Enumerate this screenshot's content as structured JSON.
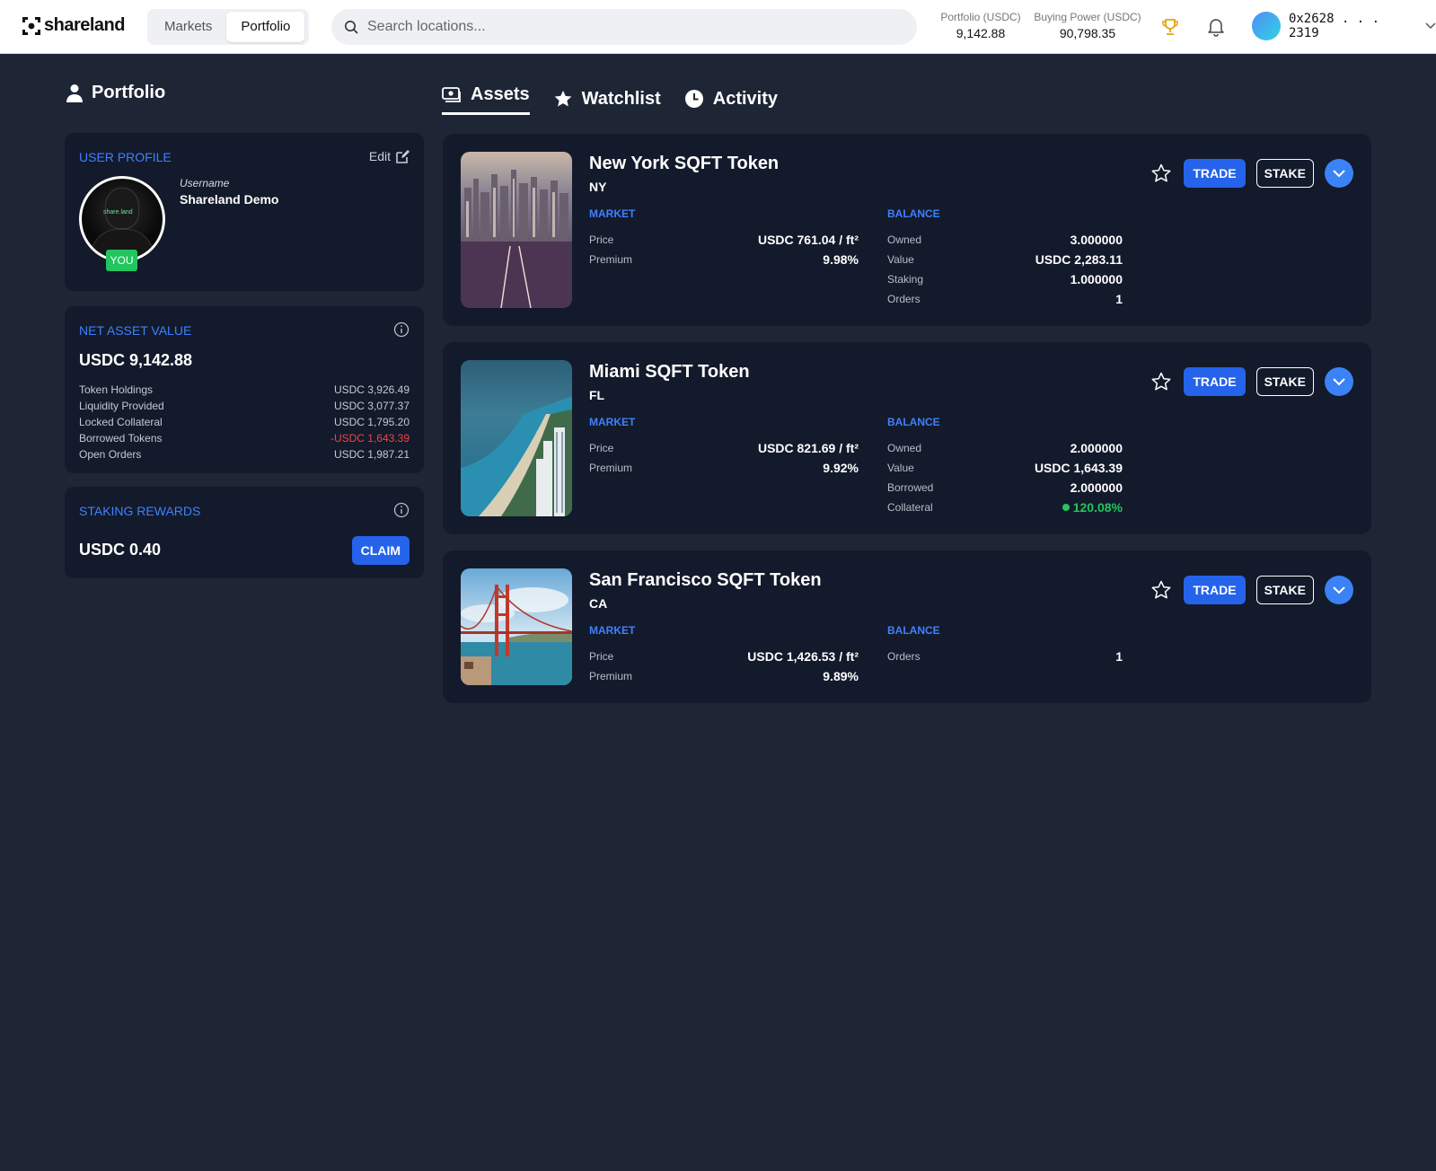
{
  "header": {
    "logo_text": "shareland",
    "nav_tabs": [
      {
        "label": "Markets"
      },
      {
        "label": "Portfolio"
      }
    ],
    "search_placeholder": "Search locations...",
    "portfolio_label": "Portfolio (USDC)",
    "portfolio_value": "9,142.88",
    "buying_power_label": "Buying Power (USDC)",
    "buying_power_value": "90,798.35",
    "wallet_address": "0x2628 . . . 2319",
    "accent_color": "#2563eb"
  },
  "sidebar": {
    "title": "Portfolio",
    "profile": {
      "section_title": "USER PROFILE",
      "edit_label": "Edit",
      "username_label": "Username",
      "username": "Shareland Demo",
      "you_badge": "YOU",
      "avatar_logo_text": "share.land"
    },
    "net_asset": {
      "section_title": "NET ASSET VALUE",
      "total": "USDC 9,142.88",
      "rows": [
        {
          "label": "Token Holdings",
          "value": "USDC 3,926.49"
        },
        {
          "label": "Liquidity Provided",
          "value": "USDC 3,077.37"
        },
        {
          "label": "Locked Collateral",
          "value": "USDC 1,795.20"
        },
        {
          "label": "Borrowed Tokens",
          "value": "-USDC 1,643.39"
        },
        {
          "label": "Open Orders",
          "value": "USDC 1,987.21"
        }
      ]
    },
    "staking": {
      "section_title": "STAKING REWARDS",
      "total": "USDC 0.40",
      "claim_label": "CLAIM"
    }
  },
  "tabs": [
    {
      "label": "Assets",
      "icon": "money-icon"
    },
    {
      "label": "Watchlist",
      "icon": "star-icon"
    },
    {
      "label": "Activity",
      "icon": "clock-icon"
    }
  ],
  "assets": [
    {
      "name": "New York SQFT Token",
      "state": "NY",
      "market_title": "MARKET",
      "balance_title": "BALANCE",
      "price_label": "Price",
      "price": "USDC 761.04 / ft²",
      "premium_label": "Premium",
      "premium": "9.98%",
      "balance": [
        {
          "label": "Owned",
          "value": "3.000000"
        },
        {
          "label": "Value",
          "value": "USDC 2,283.11"
        },
        {
          "label": "Staking",
          "value": "1.000000"
        },
        {
          "label": "Orders",
          "value": "1"
        }
      ],
      "trade_label": "TRADE",
      "stake_label": "STAKE"
    },
    {
      "name": "Miami SQFT Token",
      "state": "FL",
      "market_title": "MARKET",
      "balance_title": "BALANCE",
      "price_label": "Price",
      "price": "USDC 821.69 / ft²",
      "premium_label": "Premium",
      "premium": "9.92%",
      "balance": [
        {
          "label": "Owned",
          "value": "2.000000"
        },
        {
          "label": "Value",
          "value": "USDC 1,643.39"
        },
        {
          "label": "Borrowed",
          "value": "2.000000"
        },
        {
          "label": "Collateral",
          "value": "120.08%"
        }
      ],
      "trade_label": "TRADE",
      "stake_label": "STAKE"
    },
    {
      "name": "San Francisco SQFT Token",
      "state": "CA",
      "market_title": "MARKET",
      "balance_title": "BALANCE",
      "price_label": "Price",
      "price": "USDC 1,426.53 / ft²",
      "premium_label": "Premium",
      "premium": "9.89%",
      "balance": [
        {
          "label": "Orders",
          "value": "1"
        }
      ],
      "trade_label": "TRADE",
      "stake_label": "STAKE"
    }
  ]
}
